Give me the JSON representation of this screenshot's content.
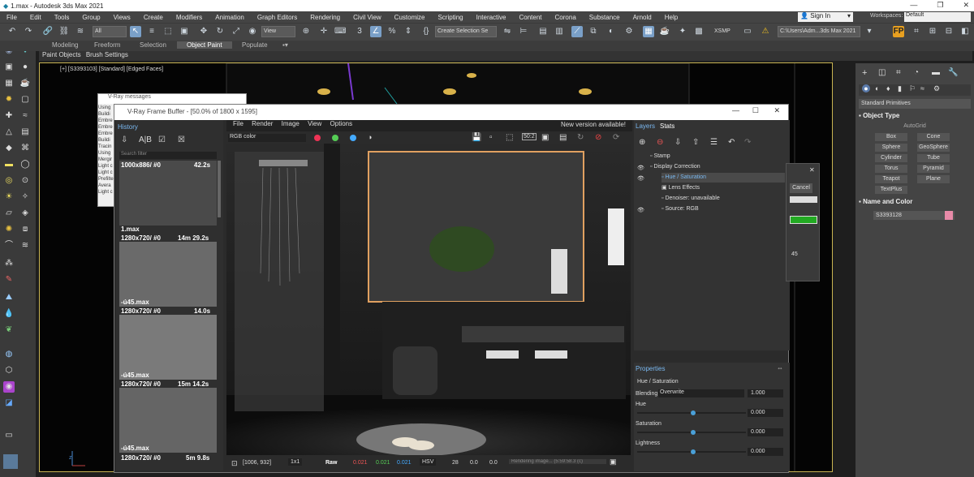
{
  "window": {
    "title": "1.max - Autodesk 3ds Max 2021"
  },
  "menu": [
    "File",
    "Edit",
    "Tools",
    "Group",
    "Views",
    "Create",
    "Modifiers",
    "Animation",
    "Graph Editors",
    "Rendering",
    "Civil View",
    "Customize",
    "Scripting",
    "Interactive",
    "Content",
    "Corona",
    "Substance",
    "Arnold",
    "Help"
  ],
  "account": {
    "signin": "Sign In",
    "workspaces_label": "Workspaces:",
    "workspace": "Default"
  },
  "toolbar": {
    "filter": "All",
    "coord": "View",
    "selection_set": "Create Selection Se",
    "xsmp": "XSMP",
    "path": "C:\\Users\\Adm...3ds Max 2021"
  },
  "ribbon": {
    "tabs": [
      "Modeling",
      "Freeform",
      "Selection",
      "Object Paint",
      "Populate"
    ],
    "active": "Object Paint",
    "sub": [
      "Paint Objects",
      "Brush Settings"
    ]
  },
  "viewport": {
    "label": "[+] [S3393103] [Standard] [Edged Faces]"
  },
  "vray_messages": {
    "title": "V-Ray messages",
    "lines": [
      "Using",
      "Buildi",
      "Embre",
      "Embre",
      "Embre",
      "Buildi",
      "Tracin",
      "Using",
      "Mergir",
      "Light c",
      "Light c",
      "Prefilte",
      "Avera",
      "Light c"
    ]
  },
  "vfb": {
    "title": "V-Ray Frame Buffer - [50.0% of 1800 x 1595]",
    "menu": [
      "File",
      "Render",
      "Image",
      "View",
      "Options"
    ],
    "notice": "New version available!",
    "history_label": "History",
    "search_placeholder": "Search filter",
    "channel": "RGB color",
    "zoom": "50:2",
    "history": [
      {
        "res": "1000x886/ #0",
        "time": "42.2s",
        "name": "1.max"
      },
      {
        "res": "1280x720/ #0",
        "time": "14m 29.2s",
        "name": "-ú45.max"
      },
      {
        "res": "1280x720/ #0",
        "time": "14.0s",
        "name": "-ú45.max"
      },
      {
        "res": "1280x720/ #0",
        "time": "15m 14.2s",
        "name": "-ú45.max"
      },
      {
        "res": "1280x720/ #0",
        "time": "5m 9.8s",
        "name": "-ú45.max"
      }
    ],
    "status": {
      "coords": "[1006, 932]",
      "ratio": "1x1",
      "mode": "Raw",
      "r": "0.021",
      "g": "0.021",
      "b": "0.021",
      "space": "HSV",
      "h": "28",
      "s": "0.0",
      "v": "0.0",
      "msg": "Rendering image... (5:59:58.3 (c)"
    }
  },
  "layers": {
    "tabs": [
      "Layers",
      "Stats"
    ],
    "items": [
      "Stamp",
      "Display Correction",
      "Hue / Saturation",
      "Lens Effects",
      "Denoiser: unavailable",
      "Source: RGB"
    ]
  },
  "properties": {
    "title": "Properties",
    "layer": "Hue / Saturation",
    "blending_label": "Blending",
    "blending": "Overwrite",
    "blending_val": "1.000",
    "hue_label": "Hue",
    "hue_val": "0.000",
    "saturation_label": "Saturation",
    "saturation_val": "0.000",
    "lightness_label": "Lightness",
    "lightness_val": "0.000"
  },
  "dialog": {
    "cancel": "Cancel",
    "value": "45"
  },
  "command_panel": {
    "category": "Standard Primitives",
    "object_type": "Object Type",
    "autogrid": "AutoGrid",
    "buttons": [
      "Box",
      "Cone",
      "Sphere",
      "GeoSphere",
      "Cylinder",
      "Tube",
      "Torus",
      "Pyramid",
      "Teapot",
      "Plane",
      "TextPlus"
    ],
    "name_color": "Name and Color",
    "object_name": "S3393128",
    "object_color": "#e88aa8"
  }
}
